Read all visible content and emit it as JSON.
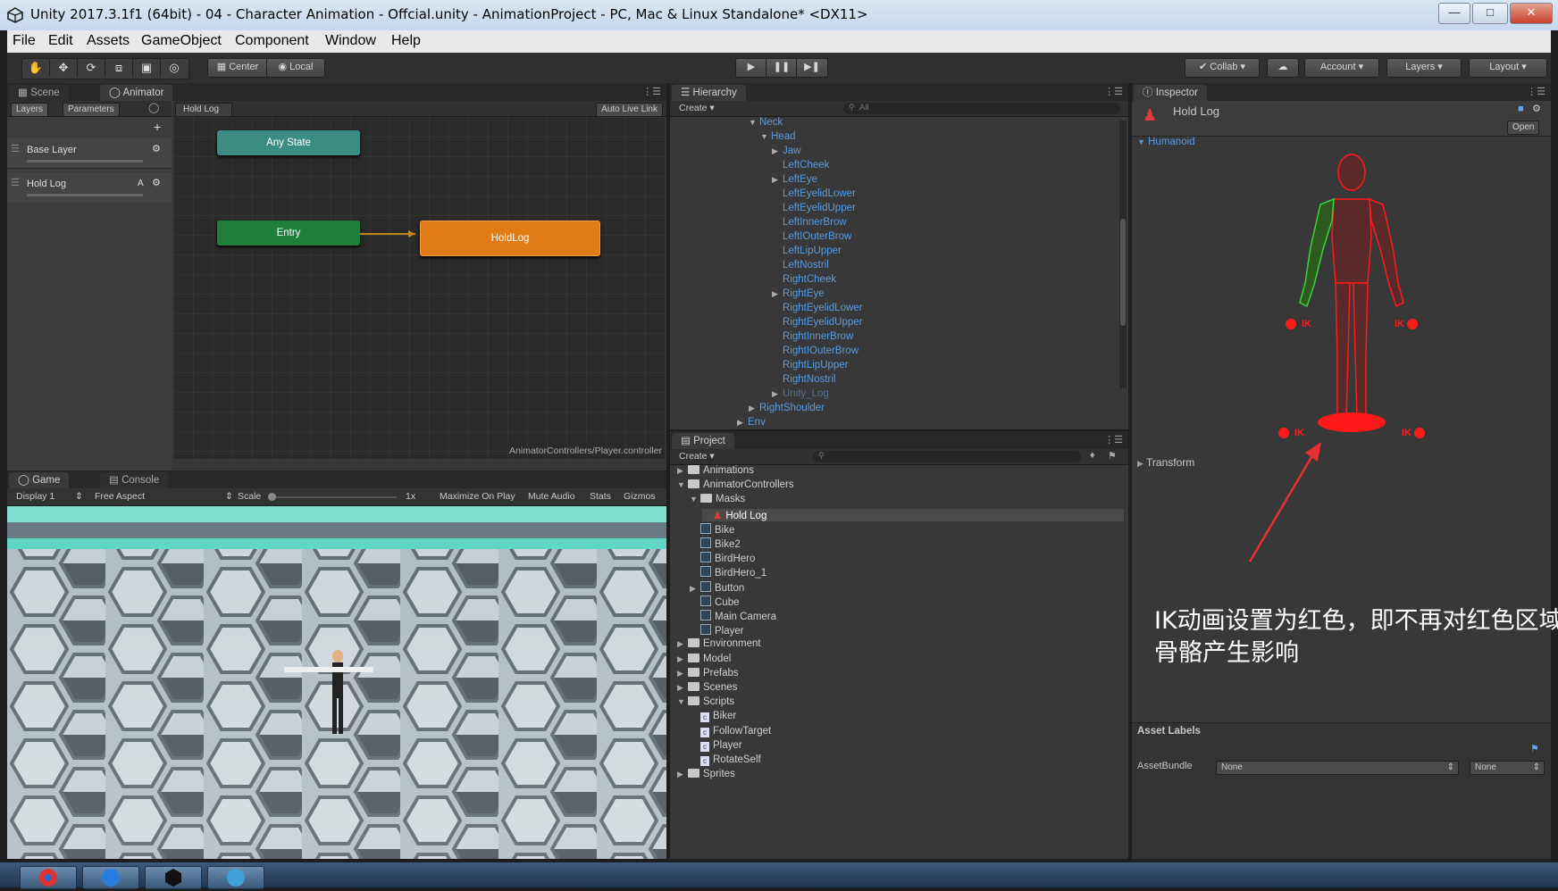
{
  "window": {
    "title": "Unity 2017.3.1f1 (64bit) - 04 - Character Animation - Offcial.unity - AnimationProject - PC, Mac & Linux Standalone* <DX11>"
  },
  "menu": [
    "File",
    "Edit",
    "Assets",
    "GameObject",
    "Component",
    "Window",
    "Help"
  ],
  "toolbar": {
    "center_label": "Center",
    "local_label": "Local",
    "collab_label": "Collab",
    "account_label": "Account",
    "layers_label": "Layers",
    "layout_label": "Layout"
  },
  "scene_tabs": {
    "scene": "Scene",
    "animator": "Animator"
  },
  "animator": {
    "layers_tab": "Layers",
    "parameters_tab": "Parameters",
    "breadcrumb": "Hold Log",
    "auto_live_link": "Auto Live Link",
    "layers": [
      {
        "name": "Base Layer"
      },
      {
        "name": "Hold Log",
        "badge": "A"
      }
    ],
    "states": {
      "any_state": "Any State",
      "entry": "Entry",
      "holdlog": "HoldLog"
    },
    "controller_path": "AnimatorControllers/Player.controller"
  },
  "game_tabs": {
    "game": "Game",
    "console": "Console"
  },
  "game_bar": {
    "display": "Display 1",
    "aspect": "Free Aspect",
    "scale_label": "Scale",
    "scale_value": "1x",
    "maximize": "Maximize On Play",
    "mute": "Mute Audio",
    "stats": "Stats",
    "gizmos": "Gizmos"
  },
  "hierarchy": {
    "tab": "Hierarchy",
    "create": "Create",
    "search_placeholder": "All",
    "items": [
      {
        "label": "Neck",
        "depth": 0,
        "arrow": "down"
      },
      {
        "label": "Head",
        "depth": 1,
        "arrow": "down"
      },
      {
        "label": "Jaw",
        "depth": 2,
        "arrow": "right"
      },
      {
        "label": "LeftCheek",
        "depth": 2,
        "arrow": ""
      },
      {
        "label": "LeftEye",
        "depth": 2,
        "arrow": "right"
      },
      {
        "label": "LeftEyelidLower",
        "depth": 2,
        "arrow": ""
      },
      {
        "label": "LeftEyelidUpper",
        "depth": 2,
        "arrow": ""
      },
      {
        "label": "LeftInnerBrow",
        "depth": 2,
        "arrow": ""
      },
      {
        "label": "LeftIOuterBrow",
        "depth": 2,
        "arrow": ""
      },
      {
        "label": "LeftLipUpper",
        "depth": 2,
        "arrow": ""
      },
      {
        "label": "LeftNostril",
        "depth": 2,
        "arrow": ""
      },
      {
        "label": "RightCheek",
        "depth": 2,
        "arrow": ""
      },
      {
        "label": "RightEye",
        "depth": 2,
        "arrow": "right"
      },
      {
        "label": "RightEyelidLower",
        "depth": 2,
        "arrow": ""
      },
      {
        "label": "RightEyelidUpper",
        "depth": 2,
        "arrow": ""
      },
      {
        "label": "RightInnerBrow",
        "depth": 2,
        "arrow": ""
      },
      {
        "label": "RightIOuterBrow",
        "depth": 2,
        "arrow": ""
      },
      {
        "label": "RightLipUpper",
        "depth": 2,
        "arrow": ""
      },
      {
        "label": "RightNostril",
        "depth": 2,
        "arrow": ""
      },
      {
        "label": "Unity_Log",
        "depth": 2,
        "arrow": "right",
        "dim": true
      },
      {
        "label": "RightShoulder",
        "depth": 0,
        "arrow": "right"
      },
      {
        "label": "Env",
        "depth": -1,
        "arrow": "right"
      }
    ]
  },
  "project": {
    "tab": "Project",
    "create": "Create",
    "items": [
      {
        "label": "Animations",
        "depth": 0,
        "arrow": "right",
        "icon": "folder"
      },
      {
        "label": "AnimatorControllers",
        "depth": 0,
        "arrow": "down",
        "icon": "folder"
      },
      {
        "label": "Masks",
        "depth": 1,
        "arrow": "down",
        "icon": "folder"
      },
      {
        "label": "Hold Log",
        "depth": 2,
        "arrow": "",
        "icon": "mask",
        "selected": true
      },
      {
        "label": "Bike",
        "depth": 1,
        "arrow": "",
        "icon": "asset"
      },
      {
        "label": "Bike2",
        "depth": 1,
        "arrow": "",
        "icon": "asset"
      },
      {
        "label": "BirdHero",
        "depth": 1,
        "arrow": "",
        "icon": "asset"
      },
      {
        "label": "BirdHero_1",
        "depth": 1,
        "arrow": "",
        "icon": "asset"
      },
      {
        "label": "Button",
        "depth": 1,
        "arrow": "right",
        "icon": "asset"
      },
      {
        "label": "Cube",
        "depth": 1,
        "arrow": "",
        "icon": "asset"
      },
      {
        "label": "Main Camera",
        "depth": 1,
        "arrow": "",
        "icon": "asset"
      },
      {
        "label": "Player",
        "depth": 1,
        "arrow": "",
        "icon": "asset"
      },
      {
        "label": "Environment",
        "depth": 0,
        "arrow": "right",
        "icon": "folder"
      },
      {
        "label": "Model",
        "depth": 0,
        "arrow": "right",
        "icon": "folder"
      },
      {
        "label": "Prefabs",
        "depth": 0,
        "arrow": "right",
        "icon": "folder"
      },
      {
        "label": "Scenes",
        "depth": 0,
        "arrow": "right",
        "icon": "folder"
      },
      {
        "label": "Scripts",
        "depth": 0,
        "arrow": "down",
        "icon": "folder"
      },
      {
        "label": "Biker",
        "depth": 1,
        "arrow": "",
        "icon": "script"
      },
      {
        "label": "FollowTarget",
        "depth": 1,
        "arrow": "",
        "icon": "script"
      },
      {
        "label": "Player",
        "depth": 1,
        "arrow": "",
        "icon": "script"
      },
      {
        "label": "RotateSelf",
        "depth": 1,
        "arrow": "",
        "icon": "script"
      },
      {
        "label": "Sprites",
        "depth": 0,
        "arrow": "right",
        "icon": "folder"
      }
    ]
  },
  "inspector": {
    "tab": "Inspector",
    "object_name": "Hold Log",
    "open_button": "Open",
    "humanoid": "Humanoid",
    "transform": "Transform",
    "ik_label": "IK",
    "asset_labels": "Asset Labels",
    "asset_bundle_label": "AssetBundle",
    "asset_bundle_value": "None",
    "variant_value": "None",
    "colors": {
      "masked": "#ff1a1a",
      "active": "#39d439"
    }
  },
  "annotation": {
    "text": "IK动画设置为红色，即不再对红色区域骨骼产生影响"
  }
}
